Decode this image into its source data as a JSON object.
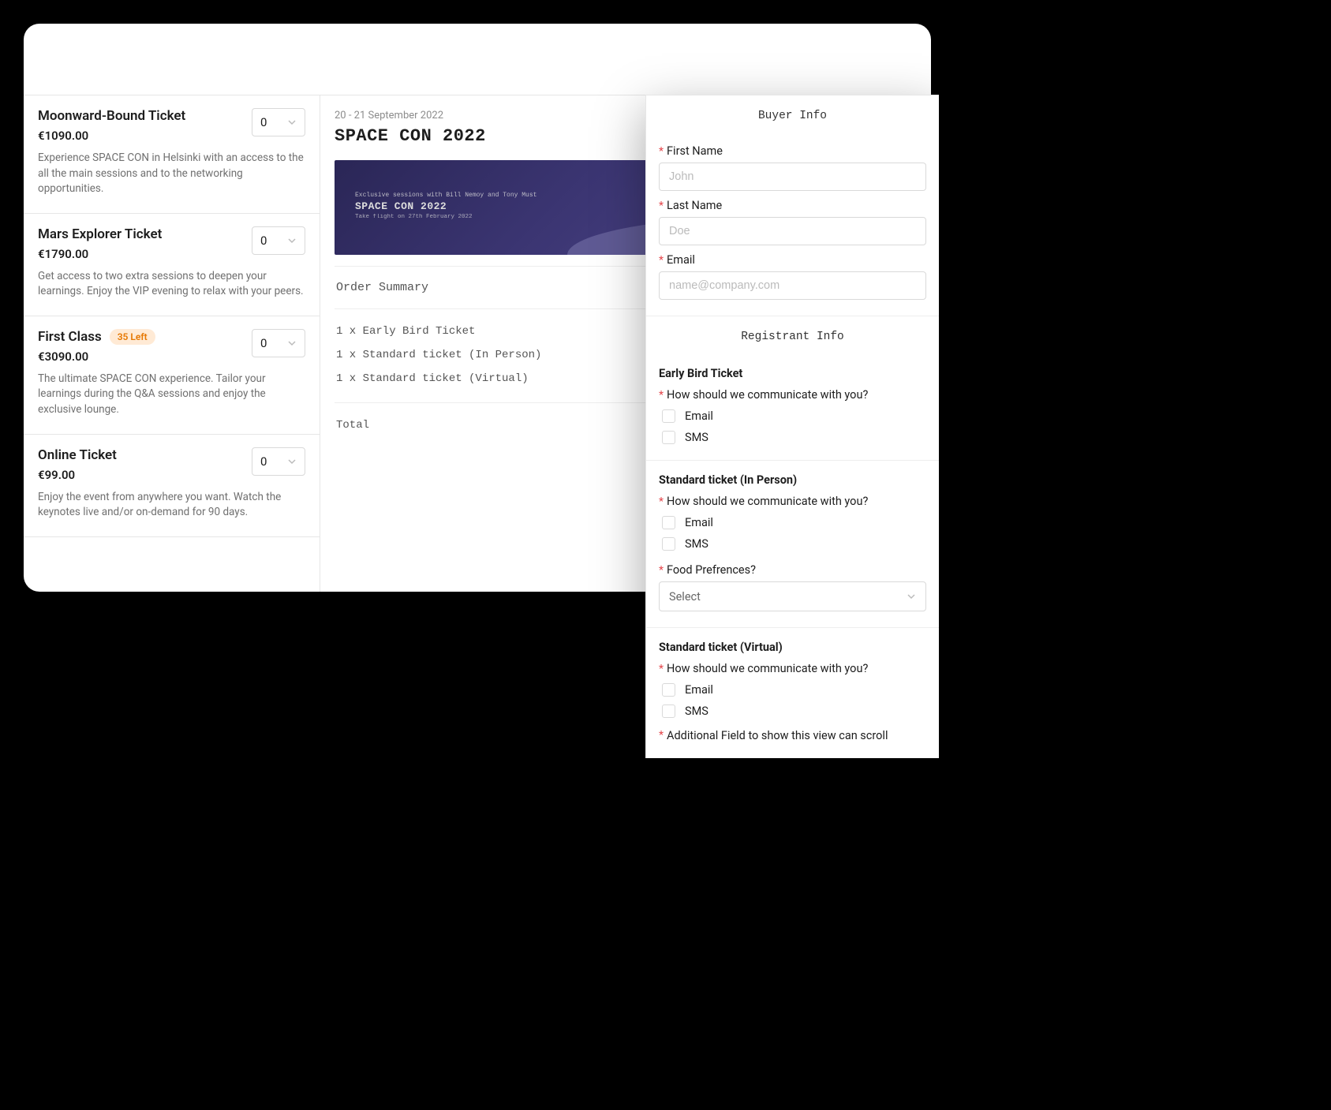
{
  "event": {
    "dates": "20 - 21 September 2022",
    "title": "SPACE CON 2022",
    "image_caption1": "Exclusive sessions with Bill Nemoy and Tony Must",
    "image_caption2": "SPACE CON 2022",
    "image_caption3": "Take flight on 27th February 2022"
  },
  "tickets": [
    {
      "name": "Moonward-Bound Ticket",
      "price": "€1090.00",
      "desc": "Experience SPACE CON in Helsinki with an access to the all the main sessions and to the networking opportunities.",
      "qty": "0"
    },
    {
      "name": "Mars Explorer Ticket",
      "price": "€1790.00",
      "desc": "Get access to two extra sessions to deepen your learnings. Enjoy the VIP evening to relax with your peers.",
      "qty": "0"
    },
    {
      "name": "First Class",
      "price": "€3090.00",
      "desc": "The ultimate SPACE CON experience. Tailor your learnings during the Q&A sessions and enjoy the exclusive lounge.",
      "qty": "0",
      "badge": "35 Left"
    },
    {
      "name": "Online Ticket",
      "price": "€99.00",
      "desc": "Enjoy the event from anywhere you want. Watch the keynotes live and/or on-demand for 90 days.",
      "qty": "0"
    }
  ],
  "order": {
    "heading": "Order Summary",
    "lines": [
      "1 x Early Bird Ticket",
      "1 x Standard ticket (In Person)",
      "1 x Standard ticket (Virtual)"
    ],
    "total_label": "Total"
  },
  "buyer": {
    "heading": "Buyer Info",
    "first_name_label": "First Name",
    "first_name_placeholder": "John",
    "last_name_label": "Last Name",
    "last_name_placeholder": "Doe",
    "email_label": "Email",
    "email_placeholder": "name@company.com"
  },
  "registrant": {
    "heading": "Registrant Info",
    "comm_question": "How should we communicate with you?",
    "email_opt": "Email",
    "sms_opt": "SMS",
    "food_label": "Food Prefrences?",
    "select_placeholder": "Select",
    "additional_label": "Additional Field to show this view can scroll",
    "blocks": [
      {
        "title": "Early Bird Ticket"
      },
      {
        "title": "Standard ticket (In Person)"
      },
      {
        "title": "Standard ticket (Virtual)"
      }
    ]
  },
  "star": "*"
}
